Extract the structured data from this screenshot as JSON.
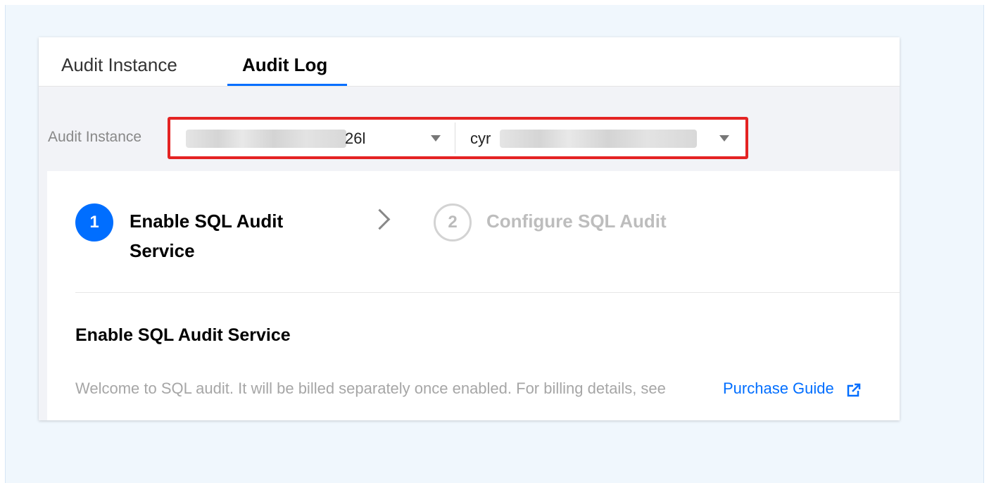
{
  "tabs": [
    {
      "label": "Audit Instance",
      "active": false
    },
    {
      "label": "Audit Log",
      "active": true
    }
  ],
  "filter": {
    "label": "Audit Instance",
    "select1": {
      "value_suffix": "26l"
    },
    "select2": {
      "value_prefix": "cyr"
    }
  },
  "steps": [
    {
      "number": "1",
      "title": "Enable SQL Audit Service",
      "active": true
    },
    {
      "number": "2",
      "title": "Configure SQL Audit",
      "active": false
    }
  ],
  "section": {
    "title": "Enable SQL Audit Service",
    "description": "Welcome to SQL audit. It will be billed separately once enabled. For billing details, see",
    "link": "Purchase Guide"
  },
  "colors": {
    "accent": "#006eff",
    "highlight_border": "#e42323",
    "background": "#f0f7fd"
  },
  "icons": {
    "step_separator": "chevron-right-icon",
    "dropdown": "caret-down-icon",
    "link": "external-link-icon"
  }
}
